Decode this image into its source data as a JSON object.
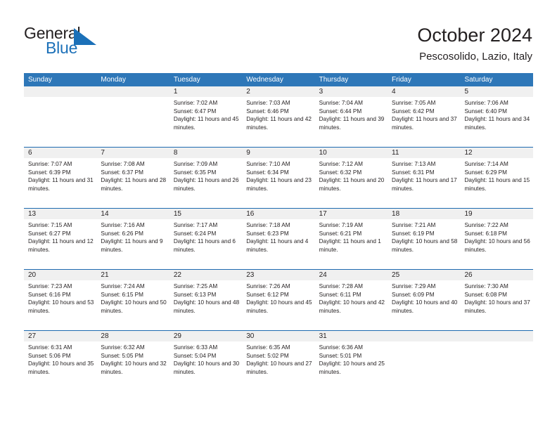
{
  "brand": {
    "word_one": "General",
    "word_two": "Blue",
    "flag_icon": "flag-triangle-icon",
    "accent_color": "#1b70b8"
  },
  "header": {
    "title": "October 2024",
    "subtitle": "Pescosolido, Lazio, Italy"
  },
  "calendar": {
    "header_color": "#2e77b8",
    "row_divider_color": "#1d6ab0",
    "day_bar_color": "#f0f0f0",
    "day_names": [
      "Sunday",
      "Monday",
      "Tuesday",
      "Wednesday",
      "Thursday",
      "Friday",
      "Saturday"
    ],
    "weeks": [
      [
        {
          "empty": true
        },
        {
          "empty": true
        },
        {
          "day": "1",
          "sunrise": "Sunrise: 7:02 AM",
          "sunset": "Sunset: 6:47 PM",
          "daylight": "Daylight: 11 hours and 45 minutes."
        },
        {
          "day": "2",
          "sunrise": "Sunrise: 7:03 AM",
          "sunset": "Sunset: 6:46 PM",
          "daylight": "Daylight: 11 hours and 42 minutes."
        },
        {
          "day": "3",
          "sunrise": "Sunrise: 7:04 AM",
          "sunset": "Sunset: 6:44 PM",
          "daylight": "Daylight: 11 hours and 39 minutes."
        },
        {
          "day": "4",
          "sunrise": "Sunrise: 7:05 AM",
          "sunset": "Sunset: 6:42 PM",
          "daylight": "Daylight: 11 hours and 37 minutes."
        },
        {
          "day": "5",
          "sunrise": "Sunrise: 7:06 AM",
          "sunset": "Sunset: 6:40 PM",
          "daylight": "Daylight: 11 hours and 34 minutes."
        }
      ],
      [
        {
          "day": "6",
          "sunrise": "Sunrise: 7:07 AM",
          "sunset": "Sunset: 6:39 PM",
          "daylight": "Daylight: 11 hours and 31 minutes."
        },
        {
          "day": "7",
          "sunrise": "Sunrise: 7:08 AM",
          "sunset": "Sunset: 6:37 PM",
          "daylight": "Daylight: 11 hours and 28 minutes."
        },
        {
          "day": "8",
          "sunrise": "Sunrise: 7:09 AM",
          "sunset": "Sunset: 6:35 PM",
          "daylight": "Daylight: 11 hours and 26 minutes."
        },
        {
          "day": "9",
          "sunrise": "Sunrise: 7:10 AM",
          "sunset": "Sunset: 6:34 PM",
          "daylight": "Daylight: 11 hours and 23 minutes."
        },
        {
          "day": "10",
          "sunrise": "Sunrise: 7:12 AM",
          "sunset": "Sunset: 6:32 PM",
          "daylight": "Daylight: 11 hours and 20 minutes."
        },
        {
          "day": "11",
          "sunrise": "Sunrise: 7:13 AM",
          "sunset": "Sunset: 6:31 PM",
          "daylight": "Daylight: 11 hours and 17 minutes."
        },
        {
          "day": "12",
          "sunrise": "Sunrise: 7:14 AM",
          "sunset": "Sunset: 6:29 PM",
          "daylight": "Daylight: 11 hours and 15 minutes."
        }
      ],
      [
        {
          "day": "13",
          "sunrise": "Sunrise: 7:15 AM",
          "sunset": "Sunset: 6:27 PM",
          "daylight": "Daylight: 11 hours and 12 minutes."
        },
        {
          "day": "14",
          "sunrise": "Sunrise: 7:16 AM",
          "sunset": "Sunset: 6:26 PM",
          "daylight": "Daylight: 11 hours and 9 minutes."
        },
        {
          "day": "15",
          "sunrise": "Sunrise: 7:17 AM",
          "sunset": "Sunset: 6:24 PM",
          "daylight": "Daylight: 11 hours and 6 minutes."
        },
        {
          "day": "16",
          "sunrise": "Sunrise: 7:18 AM",
          "sunset": "Sunset: 6:23 PM",
          "daylight": "Daylight: 11 hours and 4 minutes."
        },
        {
          "day": "17",
          "sunrise": "Sunrise: 7:19 AM",
          "sunset": "Sunset: 6:21 PM",
          "daylight": "Daylight: 11 hours and 1 minute."
        },
        {
          "day": "18",
          "sunrise": "Sunrise: 7:21 AM",
          "sunset": "Sunset: 6:19 PM",
          "daylight": "Daylight: 10 hours and 58 minutes."
        },
        {
          "day": "19",
          "sunrise": "Sunrise: 7:22 AM",
          "sunset": "Sunset: 6:18 PM",
          "daylight": "Daylight: 10 hours and 56 minutes."
        }
      ],
      [
        {
          "day": "20",
          "sunrise": "Sunrise: 7:23 AM",
          "sunset": "Sunset: 6:16 PM",
          "daylight": "Daylight: 10 hours and 53 minutes."
        },
        {
          "day": "21",
          "sunrise": "Sunrise: 7:24 AM",
          "sunset": "Sunset: 6:15 PM",
          "daylight": "Daylight: 10 hours and 50 minutes."
        },
        {
          "day": "22",
          "sunrise": "Sunrise: 7:25 AM",
          "sunset": "Sunset: 6:13 PM",
          "daylight": "Daylight: 10 hours and 48 minutes."
        },
        {
          "day": "23",
          "sunrise": "Sunrise: 7:26 AM",
          "sunset": "Sunset: 6:12 PM",
          "daylight": "Daylight: 10 hours and 45 minutes."
        },
        {
          "day": "24",
          "sunrise": "Sunrise: 7:28 AM",
          "sunset": "Sunset: 6:11 PM",
          "daylight": "Daylight: 10 hours and 42 minutes."
        },
        {
          "day": "25",
          "sunrise": "Sunrise: 7:29 AM",
          "sunset": "Sunset: 6:09 PM",
          "daylight": "Daylight: 10 hours and 40 minutes."
        },
        {
          "day": "26",
          "sunrise": "Sunrise: 7:30 AM",
          "sunset": "Sunset: 6:08 PM",
          "daylight": "Daylight: 10 hours and 37 minutes."
        }
      ],
      [
        {
          "day": "27",
          "sunrise": "Sunrise: 6:31 AM",
          "sunset": "Sunset: 5:06 PM",
          "daylight": "Daylight: 10 hours and 35 minutes."
        },
        {
          "day": "28",
          "sunrise": "Sunrise: 6:32 AM",
          "sunset": "Sunset: 5:05 PM",
          "daylight": "Daylight: 10 hours and 32 minutes."
        },
        {
          "day": "29",
          "sunrise": "Sunrise: 6:33 AM",
          "sunset": "Sunset: 5:04 PM",
          "daylight": "Daylight: 10 hours and 30 minutes."
        },
        {
          "day": "30",
          "sunrise": "Sunrise: 6:35 AM",
          "sunset": "Sunset: 5:02 PM",
          "daylight": "Daylight: 10 hours and 27 minutes."
        },
        {
          "day": "31",
          "sunrise": "Sunrise: 6:36 AM",
          "sunset": "Sunset: 5:01 PM",
          "daylight": "Daylight: 10 hours and 25 minutes."
        },
        {
          "empty": true
        },
        {
          "empty": true
        }
      ]
    ]
  }
}
